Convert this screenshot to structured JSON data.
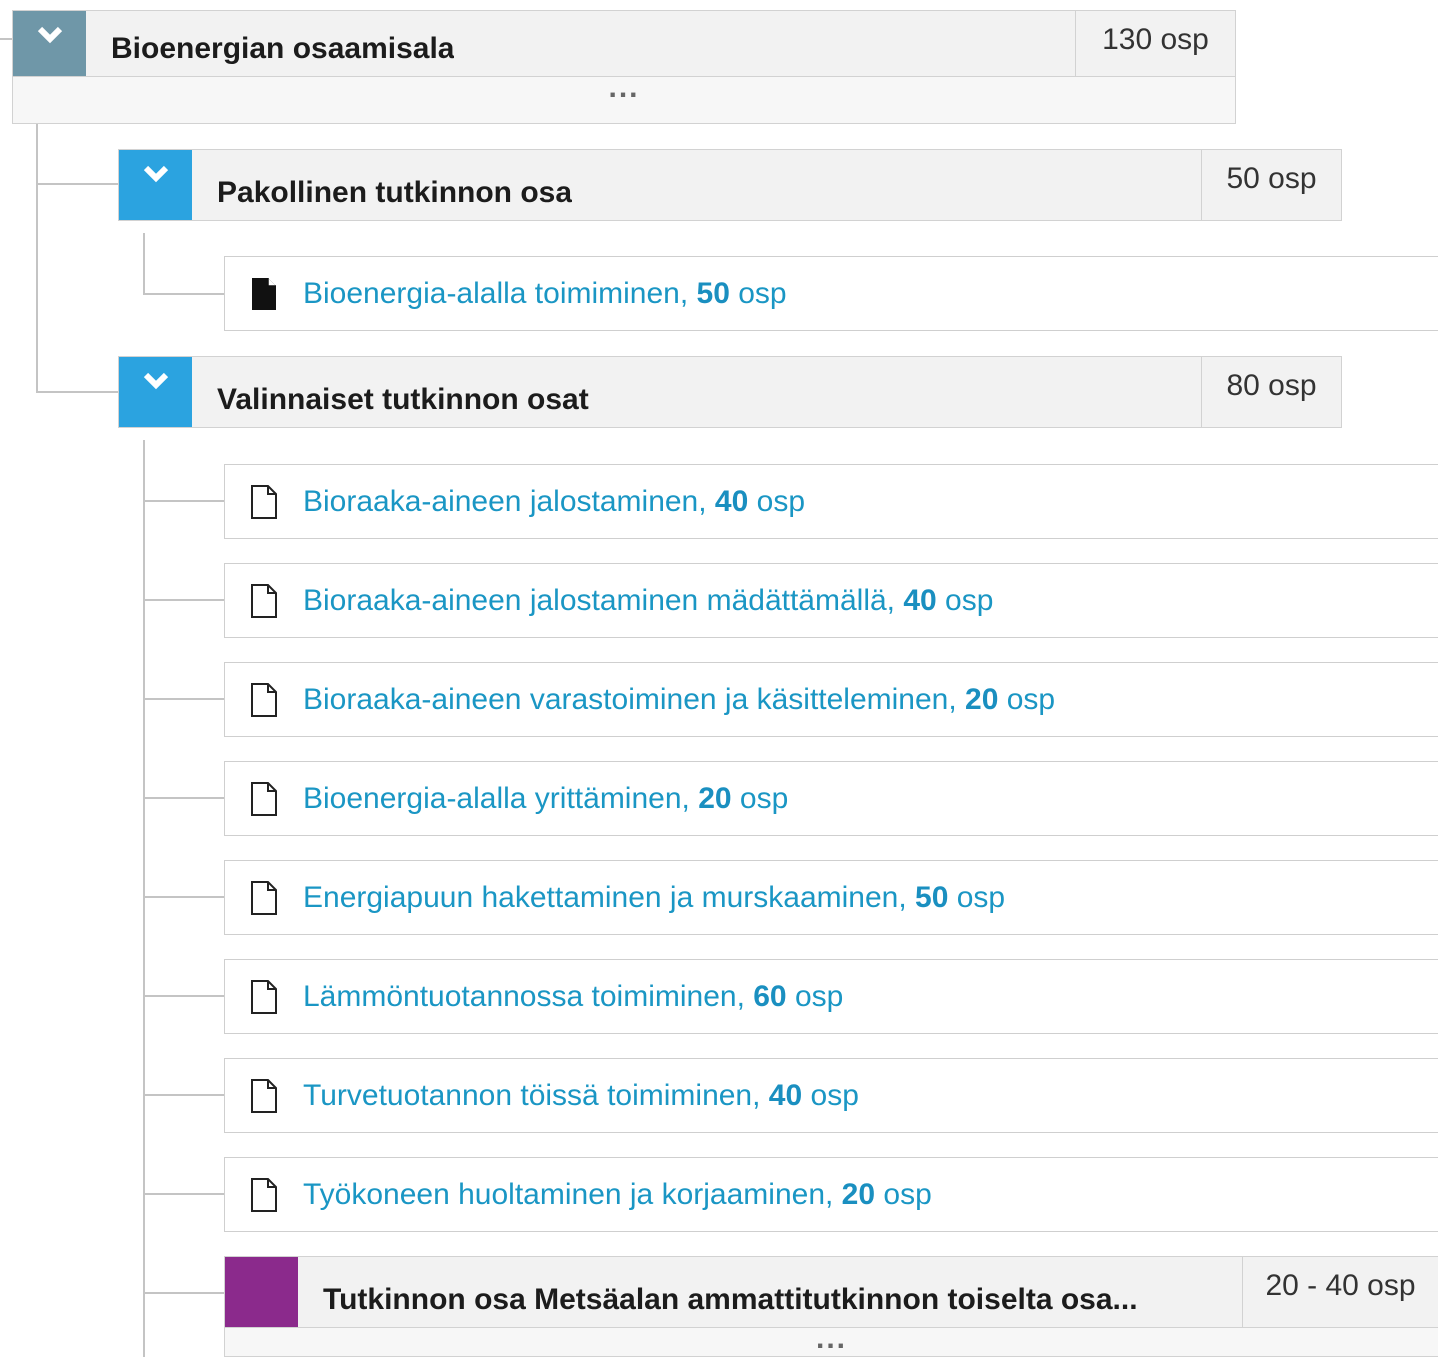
{
  "tree": {
    "root": {
      "title": "Bioenergian osaamisala",
      "credits": "130 osp",
      "more": "...",
      "accent": "#6f97a8"
    },
    "pakollinen": {
      "title": "Pakollinen tutkinnon osa",
      "credits": "50 osp",
      "accent": "#2ba3e0",
      "items": [
        {
          "name": "Bioenergia-alalla toimiminen, ",
          "value": "50",
          "unit": " osp",
          "icon": "document-filled-icon"
        }
      ]
    },
    "valinnaiset": {
      "title": "Valinnaiset tutkinnon osat",
      "credits": "80 osp",
      "accent": "#2ba3e0",
      "items": [
        {
          "name": "Bioraaka-aineen jalostaminen, ",
          "value": "40",
          "unit": " osp",
          "icon": "document-outline-icon"
        },
        {
          "name": "Bioraaka-aineen jalostaminen mädättämällä, ",
          "value": "40",
          "unit": " osp",
          "icon": "document-outline-icon"
        },
        {
          "name": "Bioraaka-aineen varastoiminen ja käsitteleminen, ",
          "value": "20",
          "unit": " osp",
          "icon": "document-outline-icon"
        },
        {
          "name": "Bioenergia-alalla yrittäminen, ",
          "value": "20",
          "unit": " osp",
          "icon": "document-outline-icon"
        },
        {
          "name": "Energiapuun hakettaminen ja murskaaminen, ",
          "value": "50",
          "unit": " osp",
          "icon": "document-outline-icon"
        },
        {
          "name": "Lämmöntuotannossa toimiminen, ",
          "value": "60",
          "unit": " osp",
          "icon": "document-outline-icon"
        },
        {
          "name": "Turvetuotannon töissä toimiminen, ",
          "value": "40",
          "unit": " osp",
          "icon": "document-outline-icon"
        },
        {
          "name": "Työkoneen huoltaminen ja korjaaminen, ",
          "value": "20",
          "unit": " osp",
          "icon": "document-outline-icon"
        }
      ],
      "subgroup": {
        "title": "Tutkinnon osa Metsäalan ammattitutkinnon toiselta osa...",
        "credits": "20 - 40 osp",
        "more": "...",
        "accent": "#8b2a8c"
      }
    }
  },
  "colors": {
    "link": "#1a96c4",
    "group_bg": "#f2f2f2"
  }
}
